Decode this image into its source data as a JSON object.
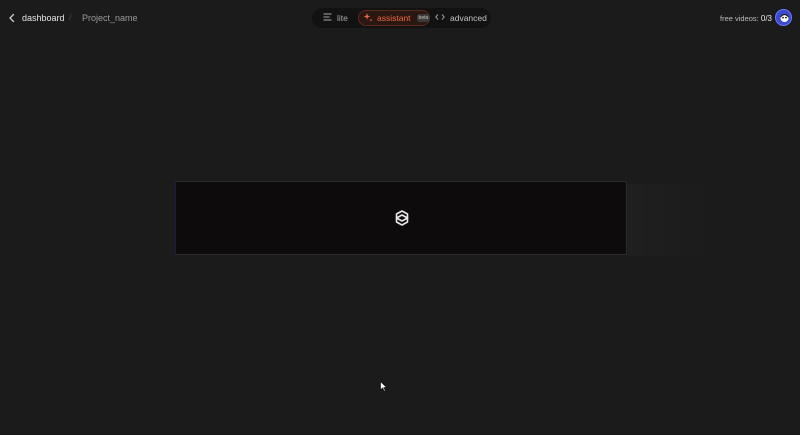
{
  "header": {
    "back_label": "dashboard",
    "separator": "/",
    "project_name": "Project_name"
  },
  "modes": [
    {
      "label": "lite",
      "icon": "lines-icon",
      "selected": false
    },
    {
      "label": "assistant",
      "icon": "sparkle-icon",
      "badge": "beta",
      "selected": true
    },
    {
      "label": "advanced",
      "icon": "code-icon",
      "selected": false
    }
  ],
  "quota": {
    "label": "free videos:",
    "count": "0/3"
  },
  "colors": {
    "background": "#1b1b1b",
    "accent": "#f06a3c",
    "avatar": "#3b4bd0"
  }
}
